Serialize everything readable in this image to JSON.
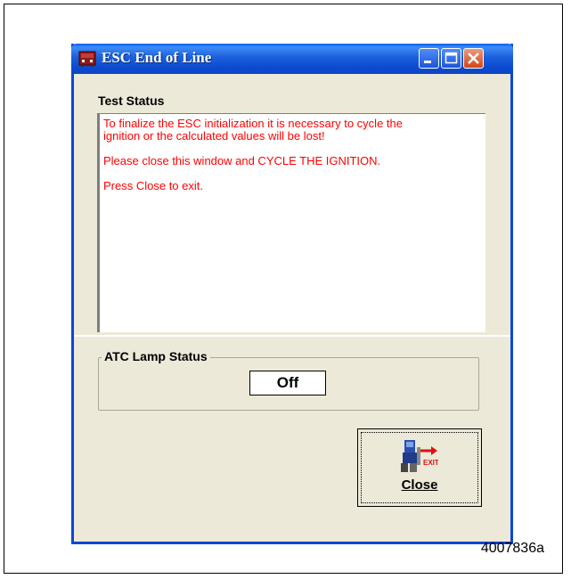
{
  "window": {
    "title": "ESC End of Line",
    "icon": "esc-app-icon"
  },
  "titlebar_buttons": [
    "minimize-icon",
    "maximize-icon",
    "close-icon"
  ],
  "test_status": {
    "label": "Test Status",
    "messages": [
      "To finalize the ESC initialization it is necessary to cycle the\nignition or the calculated values will be lost!",
      "Please close this window and CYCLE THE IGNITION.",
      "Press Close to exit."
    ],
    "text_color": "#ff0000"
  },
  "atc_lamp": {
    "label": "ATC Lamp Status",
    "value": "Off"
  },
  "close_button": {
    "label": "Close",
    "icon": "exit-icon",
    "icon_text": "EXIT"
  },
  "figure_id": "4007836a",
  "colors": {
    "titlebar": "#0b4ad0",
    "window_bg": "#ece9d8",
    "close_red": "#d24516"
  }
}
